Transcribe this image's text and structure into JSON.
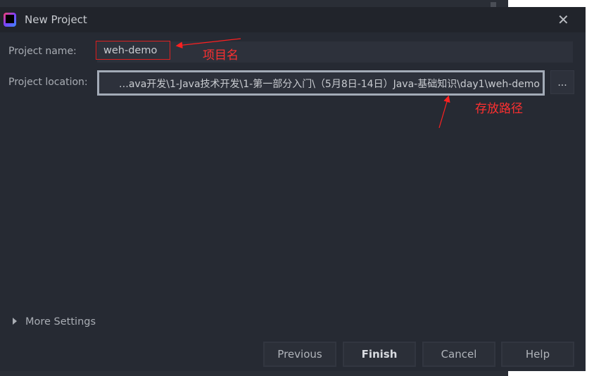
{
  "dialog": {
    "title": "New Project",
    "close_icon": "close-icon",
    "project_name_label": "Project name:",
    "project_name_value": "weh-demo",
    "project_location_label": "Project location:",
    "project_location_value": "…ava开发\\1-Java技术开发\\1-第一部分入门\\（5月8日-14日）Java-基础知识\\day1\\weh-demo",
    "browse_label": "...",
    "more_settings_label": "More Settings",
    "buttons": {
      "previous": "Previous",
      "finish": "Finish",
      "cancel": "Cancel",
      "help": "Help"
    }
  },
  "annotations": {
    "name_note": "项目名",
    "location_note": "存放路径",
    "color": "#ff3030"
  }
}
